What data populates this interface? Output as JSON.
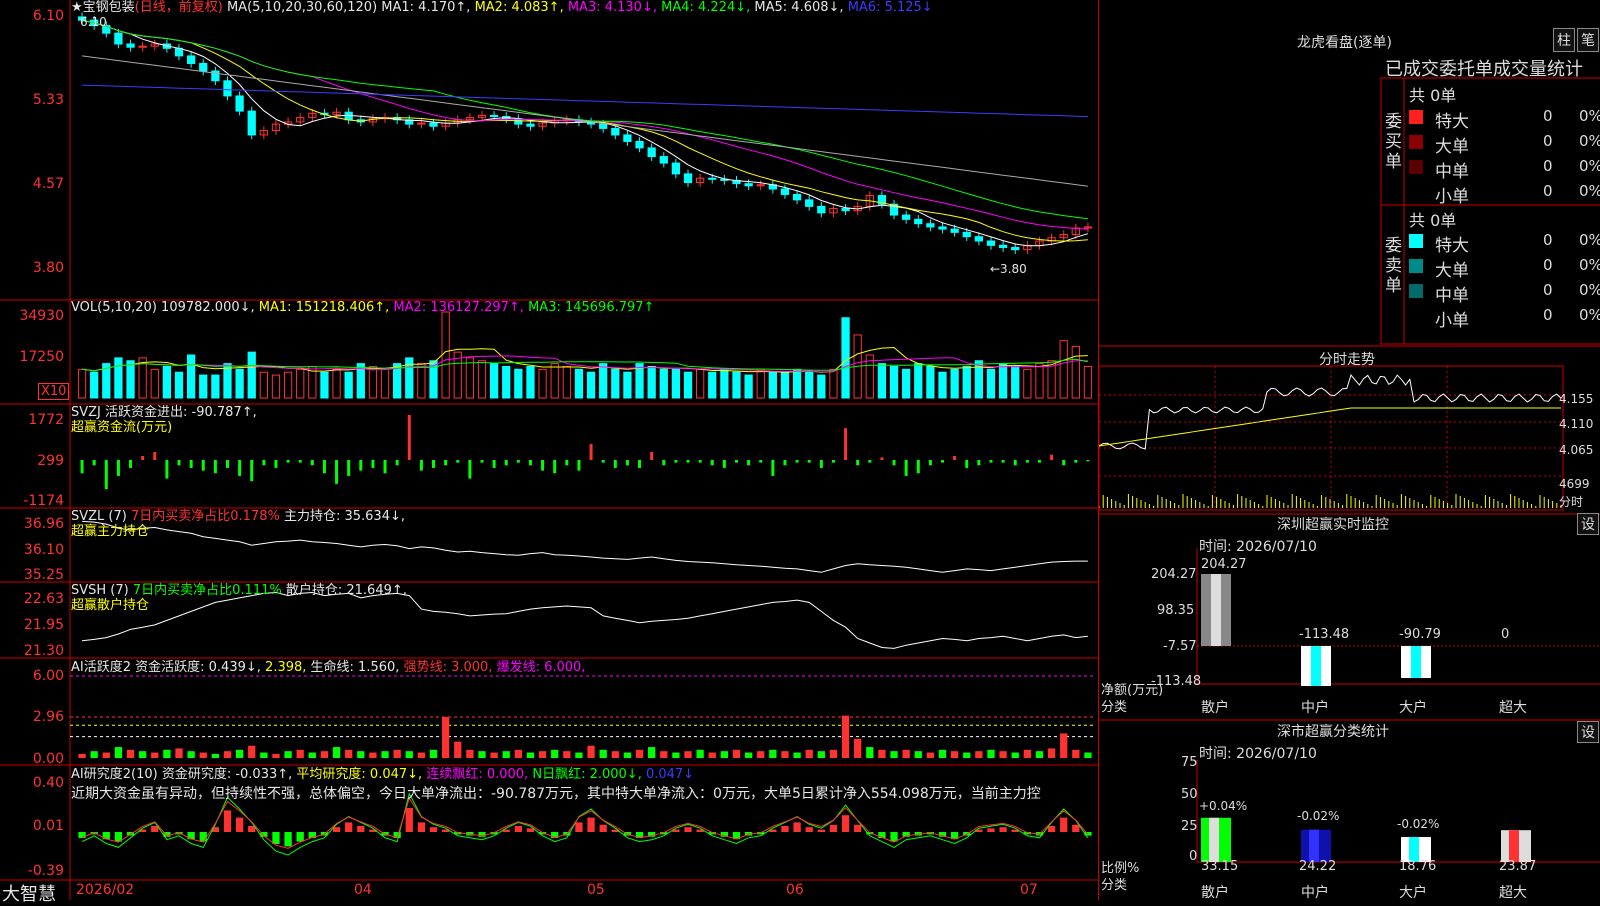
{
  "stock": {
    "name": "宝钢包装",
    "mode": "(日线，前复权)",
    "ma_title": "MA(5,10,20,30,60,120)",
    "ma1": "MA1: 4.170↑,",
    "ma2": "MA2: 4.083↑,",
    "ma3": "MA3: 4.130↓,",
    "ma4": "MA4: 4.224↓,",
    "ma5": "MA5: 4.608↓,",
    "ma6": "MA6: 5.125↓",
    "yaxis": [
      "6.10",
      "5.33",
      "4.57",
      "3.80"
    ],
    "high_label": "6.10",
    "low_label": "←3.80",
    "closes": [
      6.08,
      6.03,
      5.96,
      5.86,
      5.83,
      5.84,
      5.86,
      5.82,
      5.75,
      5.68,
      5.61,
      5.52,
      5.38,
      5.24,
      5.02,
      5.06,
      5.12,
      5.14,
      5.18,
      5.22,
      5.21,
      5.23,
      5.16,
      5.14,
      5.17,
      5.18,
      5.16,
      5.12,
      5.13,
      5.1,
      5.13,
      5.16,
      5.18,
      5.2,
      5.19,
      5.17,
      5.12,
      5.1,
      5.13,
      5.15,
      5.16,
      5.14,
      5.12,
      5.08,
      5.02,
      4.96,
      4.9,
      4.82,
      4.76,
      4.66,
      4.58,
      4.62,
      4.61,
      4.6,
      4.57,
      4.55,
      4.56,
      4.52,
      4.47,
      4.42,
      4.36,
      4.3,
      4.34,
      4.32,
      4.36,
      4.46,
      4.38,
      4.28,
      4.24,
      4.2,
      4.17,
      4.15,
      4.12,
      4.08,
      4.04,
      4.0,
      3.98,
      3.96,
      4.0,
      4.04,
      4.07,
      4.1,
      4.16,
      4.17
    ]
  },
  "vol": {
    "title": "VOL(5,10,20)",
    "val": "109782.000↓,",
    "ma1": "MA1: 151218.406↑,",
    "ma2": "MA2: 136127.297↑,",
    "ma3": "MA3: 145696.797↑",
    "yaxis": [
      "34930",
      "17250"
    ],
    "unit": "X10",
    "values": [
      10,
      9,
      12,
      14,
      13,
      14,
      10,
      11,
      9,
      15,
      8,
      8,
      12,
      10,
      16,
      9,
      8,
      9,
      10,
      11,
      9,
      10,
      9,
      12,
      11,
      10,
      12,
      14,
      12,
      13,
      30,
      16,
      14,
      13,
      12,
      11,
      10,
      11,
      10,
      12,
      11,
      10,
      9,
      12,
      10,
      9,
      12,
      11,
      10,
      10,
      9,
      10,
      9,
      10,
      9,
      8,
      10,
      9,
      9,
      10,
      9,
      8,
      10,
      28,
      22,
      15,
      12,
      11,
      10,
      12,
      11,
      9,
      10,
      11,
      13,
      10,
      12,
      11,
      10,
      12,
      13,
      20,
      18,
      11
    ]
  },
  "svzj": {
    "title": "SVZJ",
    "txt": "活跃资金进出: -90.787↑,",
    "sub": "超赢资金流(万元)",
    "yaxis": [
      "1772",
      "299",
      "-1174"
    ],
    "values": [
      -500,
      -200,
      -1100,
      -600,
      -300,
      150,
      300,
      -700,
      -200,
      -300,
      -400,
      -500,
      -300,
      -600,
      -800,
      -200,
      -300,
      -100,
      -100,
      -200,
      -500,
      -900,
      -600,
      -400,
      -300,
      -500,
      -200,
      1700,
      -400,
      -300,
      -200,
      -100,
      -700,
      -100,
      -300,
      -200,
      -100,
      -200,
      -400,
      -500,
      -200,
      -400,
      600,
      -100,
      -300,
      -200,
      -300,
      300,
      -200,
      -100,
      -100,
      -100,
      -200,
      -300,
      -100,
      -200,
      -100,
      -600,
      -200,
      -100,
      -100,
      -300,
      -100,
      1200,
      -200,
      -100,
      100,
      -200,
      -600,
      -500,
      -200,
      -100,
      150,
      -300,
      -200,
      -100,
      -100,
      -200,
      -100,
      -100,
      200,
      -200,
      -100,
      -50
    ]
  },
  "svzl": {
    "title": "SVZL (7)",
    "pct": "7日内买卖净占比0.178%",
    "txt": "主力持仓: 35.634↓,",
    "sub": "超赢主力持仓",
    "yaxis": [
      "36.96",
      "36.10",
      "35.25"
    ],
    "values": [
      36.8,
      36.78,
      36.72,
      36.6,
      36.55,
      36.6,
      36.62,
      36.55,
      36.5,
      36.45,
      36.35,
      36.3,
      36.25,
      36.2,
      36.1,
      36.15,
      36.2,
      36.22,
      36.25,
      36.2,
      36.18,
      36.15,
      36.1,
      36.05,
      36.1,
      36.12,
      36.08,
      36.0,
      36.05,
      36.02,
      35.95,
      35.9,
      35.92,
      35.88,
      35.85,
      35.82,
      35.8,
      35.85,
      35.88,
      35.82,
      35.8,
      35.78,
      35.75,
      35.72,
      35.7,
      35.68,
      35.72,
      35.75,
      35.7,
      35.65,
      35.62,
      35.6,
      35.58,
      35.55,
      35.52,
      35.5,
      35.48,
      35.45,
      35.42,
      35.4,
      35.35,
      35.3,
      35.4,
      35.5,
      35.55,
      35.52,
      35.5,
      35.48,
      35.45,
      35.4,
      35.35,
      35.3,
      35.35,
      35.4,
      35.38,
      35.35,
      35.4,
      35.45,
      35.5,
      35.55,
      35.6,
      35.62,
      35.63,
      35.63
    ]
  },
  "svsh": {
    "title": "SVSH (7)",
    "pct": "7日内买卖净占比0.111%",
    "txt": "散户持仓: 21.649↑,",
    "sub": "超赢散户持仓",
    "yaxis": [
      "22.63",
      "21.95",
      "21.30"
    ],
    "values": [
      21.55,
      21.58,
      21.62,
      21.7,
      21.8,
      21.85,
      21.9,
      22.0,
      22.1,
      22.2,
      22.3,
      22.4,
      22.45,
      22.5,
      22.55,
      22.6,
      22.62,
      22.55,
      22.6,
      22.62,
      22.55,
      22.58,
      22.6,
      22.5,
      22.55,
      22.58,
      22.6,
      22.55,
      22.25,
      22.2,
      22.18,
      22.15,
      22.1,
      22.12,
      22.14,
      22.15,
      22.2,
      22.25,
      22.28,
      22.3,
      22.32,
      22.3,
      22.28,
      22.1,
      22.05,
      22.0,
      21.95,
      21.98,
      22.0,
      22.02,
      22.05,
      22.1,
      22.15,
      22.2,
      22.25,
      22.3,
      22.35,
      22.4,
      22.42,
      22.45,
      22.4,
      22.2,
      22.0,
      21.85,
      21.6,
      21.5,
      21.4,
      21.38,
      21.45,
      21.5,
      21.55,
      21.6,
      21.58,
      21.55,
      21.6,
      21.62,
      21.65,
      21.6,
      21.55,
      21.6,
      21.65,
      21.68,
      21.62,
      21.65
    ]
  },
  "ai1": {
    "title": "AI活跃度2",
    "txt": "资金活跃度: 0.439↓,",
    "v2": "2.398,",
    "life": "生命线: 1.560,",
    "strong": "强势线: 3.000,",
    "burst": "爆发线: 6.000,",
    "yaxis": [
      "6.00",
      "2.96",
      "0.00"
    ],
    "values": [
      0.3,
      0.5,
      0.4,
      0.8,
      0.6,
      0.5,
      0.4,
      0.6,
      0.7,
      0.5,
      0.4,
      0.3,
      0.5,
      0.6,
      0.9,
      0.4,
      0.3,
      0.5,
      0.6,
      0.4,
      0.5,
      0.8,
      0.6,
      0.5,
      0.4,
      0.5,
      0.6,
      0.5,
      0.4,
      0.6,
      3.0,
      1.2,
      0.6,
      0.5,
      0.4,
      0.5,
      0.6,
      0.4,
      0.5,
      0.6,
      0.5,
      0.4,
      0.9,
      0.6,
      0.5,
      0.4,
      0.6,
      0.8,
      0.5,
      0.4,
      0.5,
      0.6,
      0.4,
      0.5,
      0.6,
      0.4,
      0.5,
      0.6,
      0.5,
      0.4,
      0.6,
      0.5,
      0.6,
      3.1,
      1.4,
      0.8,
      0.6,
      0.5,
      0.6,
      0.5,
      0.4,
      0.6,
      0.5,
      0.4,
      0.5,
      0.6,
      0.5,
      0.4,
      0.6,
      0.5,
      0.7,
      1.8,
      0.6,
      0.4
    ]
  },
  "ai2": {
    "title": "AI研究度2(10)",
    "txt": "资金研究度: -0.033↑,",
    "avg": "平均研究度: 0.047↓,",
    "cont": "连续飘红: 0.000,",
    "nday": "N日飘红: 2.000↓,",
    "last": "0.047↓",
    "yaxis": [
      "0.40",
      "0.01",
      "-0.39"
    ],
    "comment": "近期大资金虽有异动，但持续性不强，总体偏空，今日大单净流出：-90.787万元，其中特大单净流入：0万元，大单5日累计净入554.098万元，当前主力控",
    "values": [
      -0.05,
      -0.02,
      -0.06,
      -0.08,
      -0.03,
      0.02,
      0.05,
      -0.04,
      -0.02,
      -0.06,
      -0.08,
      0.04,
      0.18,
      0.12,
      0.05,
      -0.04,
      -0.1,
      -0.12,
      -0.08,
      -0.05,
      -0.03,
      0.04,
      0.08,
      0.05,
      0.02,
      -0.03,
      -0.05,
      0.2,
      0.08,
      0.04,
      0.02,
      -0.02,
      -0.03,
      -0.04,
      -0.02,
      0.02,
      0.05,
      0.03,
      -0.02,
      -0.05,
      -0.03,
      0.08,
      0.12,
      0.06,
      0.02,
      -0.03,
      -0.05,
      -0.04,
      -0.02,
      0.02,
      0.04,
      0.02,
      -0.02,
      -0.04,
      -0.06,
      -0.03,
      -0.02,
      0.02,
      0.05,
      0.08,
      0.04,
      0.02,
      0.06,
      0.14,
      0.06,
      -0.02,
      -0.05,
      -0.08,
      -0.04,
      -0.03,
      -0.02,
      -0.04,
      -0.06,
      -0.03,
      0.02,
      0.03,
      0.04,
      0.02,
      -0.02,
      -0.03,
      0.05,
      0.12,
      0.06,
      -0.03
    ]
  },
  "xaxis": [
    "2026/02",
    "04",
    "05",
    "06",
    "07"
  ],
  "brand": "大智慧",
  "right": {
    "dragon_title": "龙虎看盘(逐单)",
    "btn1": "柱",
    "btn2": "笔",
    "stat_title": "已成交委托单成交量统计",
    "buy_label": "委买单",
    "sell_label": "委卖单",
    "buy": {
      "total": "共 0单",
      "rows": [
        {
          "n": "特大",
          "v": "0",
          "p": "0%"
        },
        {
          "n": "大单",
          "v": "0",
          "p": "0%"
        },
        {
          "n": "中单",
          "v": "0",
          "p": "0%"
        },
        {
          "n": "小单",
          "v": "0",
          "p": "0%"
        }
      ]
    },
    "sell": {
      "total": "共 0单",
      "rows": [
        {
          "n": "特大",
          "v": "0",
          "p": "0%"
        },
        {
          "n": "大单",
          "v": "0",
          "p": "0%"
        },
        {
          "n": "中单",
          "v": "0",
          "p": "0%"
        },
        {
          "n": "小单",
          "v": "0",
          "p": "0%"
        }
      ]
    },
    "intraday_title": "分时走势",
    "intraday_y": [
      "4.155",
      "4.110",
      "4.065"
    ],
    "intraday_vol": "4699",
    "intraday_vol_unit": "分时",
    "monitor_title": "深圳超赢实时监控",
    "set": "设",
    "monitor_time": "时间: 2026/07/10",
    "monitor_y": [
      "204.27",
      "98.35",
      "-7.57",
      "-113.48"
    ],
    "monitor_ylabel": "净额(万元)",
    "monitor_xlabel": "分类",
    "monitor_vals": [
      "204.27",
      "-113.48",
      "-90.79",
      "0"
    ],
    "cats": [
      "散户",
      "中户",
      "大户",
      "超大"
    ],
    "class_title": "深市超赢分类统计",
    "class_time": "时间: 2026/07/10",
    "class_y": [
      "75",
      "50",
      "25",
      "0"
    ],
    "class_ylabel": "比例%",
    "class_xlabel": "分类",
    "class_pct": [
      "+0.04%",
      "-0.02%",
      "-0.02%",
      ""
    ],
    "class_vals": [
      "33.15",
      "24.22",
      "18.76",
      "23.87"
    ]
  }
}
